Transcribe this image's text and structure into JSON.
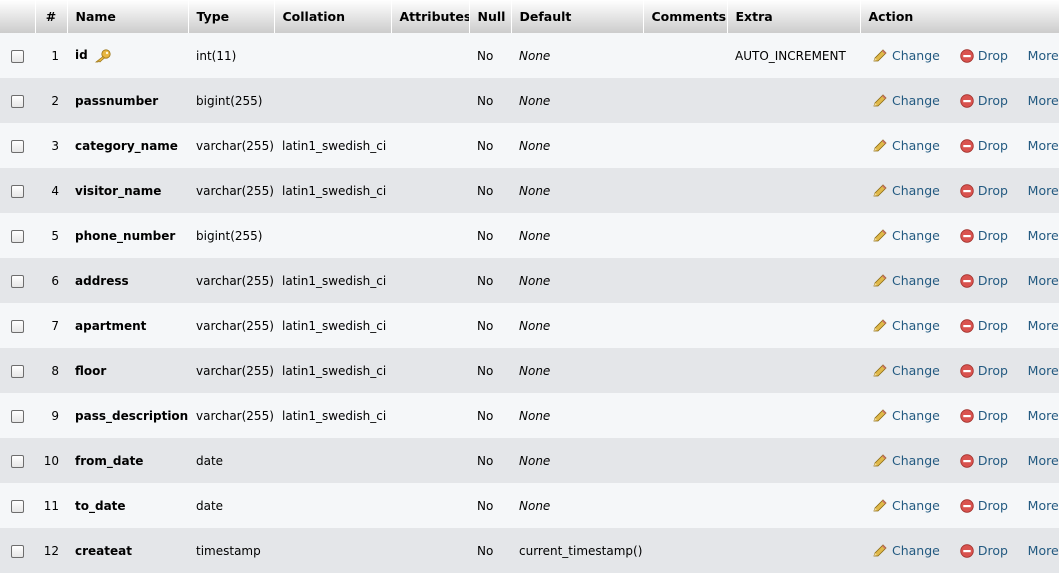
{
  "table": {
    "headers": {
      "num": "#",
      "name": "Name",
      "type": "Type",
      "collation": "Collation",
      "attributes": "Attributes",
      "null": "Null",
      "default": "Default",
      "comments": "Comments",
      "extra": "Extra",
      "action": "Action"
    },
    "action_labels": {
      "change": "Change",
      "drop": "Drop",
      "more": "More"
    },
    "colors": {
      "link": "#235a81",
      "drop_icon": "#d9534f",
      "pencil": "#e0b94a",
      "key": "#e8b640"
    },
    "rows": [
      {
        "num": "1",
        "name": "id",
        "type": "int(11)",
        "collation": "",
        "null": "No",
        "default": "None",
        "default_italic": true,
        "extra": "AUTO_INCREMENT",
        "primary_key": true
      },
      {
        "num": "2",
        "name": "passnumber",
        "type": "bigint(255)",
        "collation": "",
        "null": "No",
        "default": "None",
        "default_italic": true,
        "extra": ""
      },
      {
        "num": "3",
        "name": "category_name",
        "type": "varchar(255)",
        "collation": "latin1_swedish_ci",
        "null": "No",
        "default": "None",
        "default_italic": true,
        "extra": ""
      },
      {
        "num": "4",
        "name": "visitor_name",
        "type": "varchar(255)",
        "collation": "latin1_swedish_ci",
        "null": "No",
        "default": "None",
        "default_italic": true,
        "extra": ""
      },
      {
        "num": "5",
        "name": "phone_number",
        "type": "bigint(255)",
        "collation": "",
        "null": "No",
        "default": "None",
        "default_italic": true,
        "extra": ""
      },
      {
        "num": "6",
        "name": "address",
        "type": "varchar(255)",
        "collation": "latin1_swedish_ci",
        "null": "No",
        "default": "None",
        "default_italic": true,
        "extra": ""
      },
      {
        "num": "7",
        "name": "apartment",
        "type": "varchar(255)",
        "collation": "latin1_swedish_ci",
        "null": "No",
        "default": "None",
        "default_italic": true,
        "extra": ""
      },
      {
        "num": "8",
        "name": "floor",
        "type": "varchar(255)",
        "collation": "latin1_swedish_ci",
        "null": "No",
        "default": "None",
        "default_italic": true,
        "extra": ""
      },
      {
        "num": "9",
        "name": "pass_description",
        "type": "varchar(255)",
        "collation": "latin1_swedish_ci",
        "null": "No",
        "default": "None",
        "default_italic": true,
        "extra": ""
      },
      {
        "num": "10",
        "name": "from_date",
        "type": "date",
        "collation": "",
        "null": "No",
        "default": "None",
        "default_italic": true,
        "extra": ""
      },
      {
        "num": "11",
        "name": "to_date",
        "type": "date",
        "collation": "",
        "null": "No",
        "default": "None",
        "default_italic": true,
        "extra": ""
      },
      {
        "num": "12",
        "name": "createat",
        "type": "timestamp",
        "collation": "",
        "null": "No",
        "default": "current_timestamp()",
        "default_italic": false,
        "extra": ""
      }
    ]
  }
}
